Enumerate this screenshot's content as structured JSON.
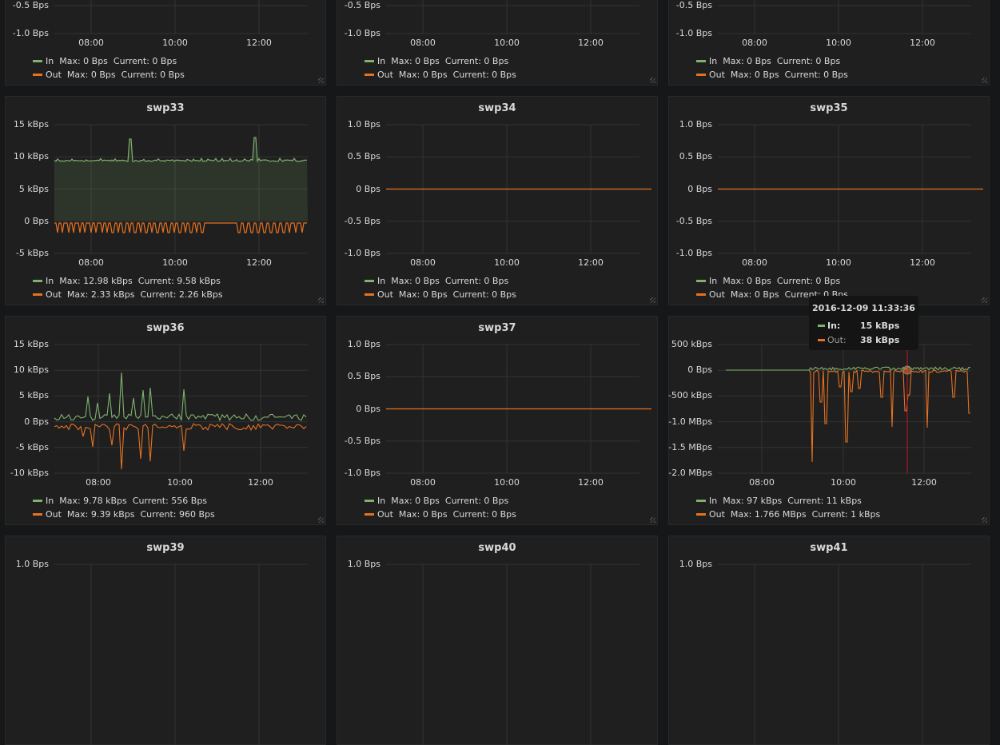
{
  "colors": {
    "in": "#7eb26d",
    "out": "#e5721f",
    "grid": "#333333"
  },
  "panels": [
    {
      "id": "swp30",
      "title": "",
      "yticks": [
        "-0.5 Bps",
        "-1.0 Bps"
      ],
      "xticks": [
        "08:00",
        "10:00",
        "12:00"
      ],
      "type": "flat",
      "legend_in": "In  Max: 0 Bps  Current: 0 Bps",
      "legend_out": "Out  Max: 0 Bps  Current: 0 Bps"
    },
    {
      "id": "swp31",
      "title": "",
      "yticks": [
        "-0.5 Bps",
        "-1.0 Bps"
      ],
      "xticks": [
        "08:00",
        "10:00",
        "12:00"
      ],
      "type": "flat",
      "legend_in": "In  Max: 0 Bps  Current: 0 Bps",
      "legend_out": "Out  Max: 0 Bps  Current: 0 Bps"
    },
    {
      "id": "swp32",
      "title": "",
      "yticks": [
        "-0.5 Bps",
        "-1.0 Bps"
      ],
      "xticks": [
        "08:00",
        "10:00",
        "12:00"
      ],
      "type": "flat",
      "legend_in": "In  Max: 0 Bps  Current: 0 Bps",
      "legend_out": "Out  Max: 0 Bps  Current: 0 Bps"
    },
    {
      "id": "swp33",
      "title": "swp33",
      "yticks": [
        "15 kBps",
        "10 kBps",
        "5 kBps",
        "0 Bps",
        "-5 kBps"
      ],
      "xticks": [
        "08:00",
        "10:00",
        "12:00"
      ],
      "type": "swp33",
      "legend_in": "In  Max: 12.98 kBps  Current: 9.58 kBps",
      "legend_out": "Out  Max: 2.33 kBps  Current: 2.26 kBps"
    },
    {
      "id": "swp34",
      "title": "swp34",
      "yticks": [
        "1.0 Bps",
        "0.5 Bps",
        "0 Bps",
        "-0.5 Bps",
        "-1.0 Bps"
      ],
      "xticks": [
        "08:00",
        "10:00",
        "12:00"
      ],
      "type": "flat",
      "legend_in": "In  Max: 0 Bps  Current: 0 Bps",
      "legend_out": "Out  Max: 0 Bps  Current: 0 Bps"
    },
    {
      "id": "swp35",
      "title": "swp35",
      "yticks": [
        "1.0 Bps",
        "0.5 Bps",
        "0 Bps",
        "-0.5 Bps",
        "-1.0 Bps"
      ],
      "xticks": [
        "08:00",
        "10:00",
        "12:00"
      ],
      "type": "flat",
      "legend_in": "In  Max: 0 Bps  Current: 0 Bps",
      "legend_out": "Out  Max: 0 Bps  Current: 0 Bps"
    },
    {
      "id": "swp36",
      "title": "swp36",
      "yticks": [
        "15 kBps",
        "10 kBps",
        "5 kBps",
        "0 Bps",
        "-5 kBps",
        "-10 kBps"
      ],
      "xticks": [
        "08:00",
        "10:00",
        "12:00"
      ],
      "type": "swp36",
      "legend_in": "In  Max: 9.78 kBps  Current: 556 Bps",
      "legend_out": "Out  Max: 9.39 kBps  Current: 960 Bps"
    },
    {
      "id": "swp37",
      "title": "swp37",
      "yticks": [
        "1.0 Bps",
        "0.5 Bps",
        "0 Bps",
        "-0.5 Bps",
        "-1.0 Bps"
      ],
      "xticks": [
        "08:00",
        "10:00",
        "12:00"
      ],
      "type": "flat",
      "legend_in": "In  Max: 0 Bps  Current: 0 Bps",
      "legend_out": "Out  Max: 0 Bps  Current: 0 Bps"
    },
    {
      "id": "swp38",
      "title": "",
      "yticks": [
        "500 kBps",
        "0 Bps",
        "-500 kBps",
        "-1.0 MBps",
        "-1.5 MBps",
        "-2.0 MBps"
      ],
      "xticks": [
        "08:00",
        "10:00",
        "12:00"
      ],
      "type": "swp38",
      "legend_in": "In  Max: 97 kBps  Current: 11 kBps",
      "legend_out": "Out  Max: 1.766 MBps  Current: 1 kBps"
    },
    {
      "id": "swp39",
      "title": "swp39",
      "yticks": [
        "1.0 Bps"
      ],
      "xticks": [],
      "type": "none",
      "legend_in": "",
      "legend_out": ""
    },
    {
      "id": "swp40",
      "title": "swp40",
      "yticks": [
        "1.0 Bps"
      ],
      "xticks": [],
      "type": "none",
      "legend_in": "",
      "legend_out": ""
    },
    {
      "id": "swp41",
      "title": "swp41",
      "yticks": [
        "1.0 Bps"
      ],
      "xticks": [],
      "type": "none",
      "legend_in": "",
      "legend_out": ""
    }
  ],
  "tooltip": {
    "time": "2016-12-09 11:33:36",
    "in_label": "In:",
    "in_value": "15 kBps",
    "out_label": "Out:",
    "out_value": "38 kBps"
  }
}
